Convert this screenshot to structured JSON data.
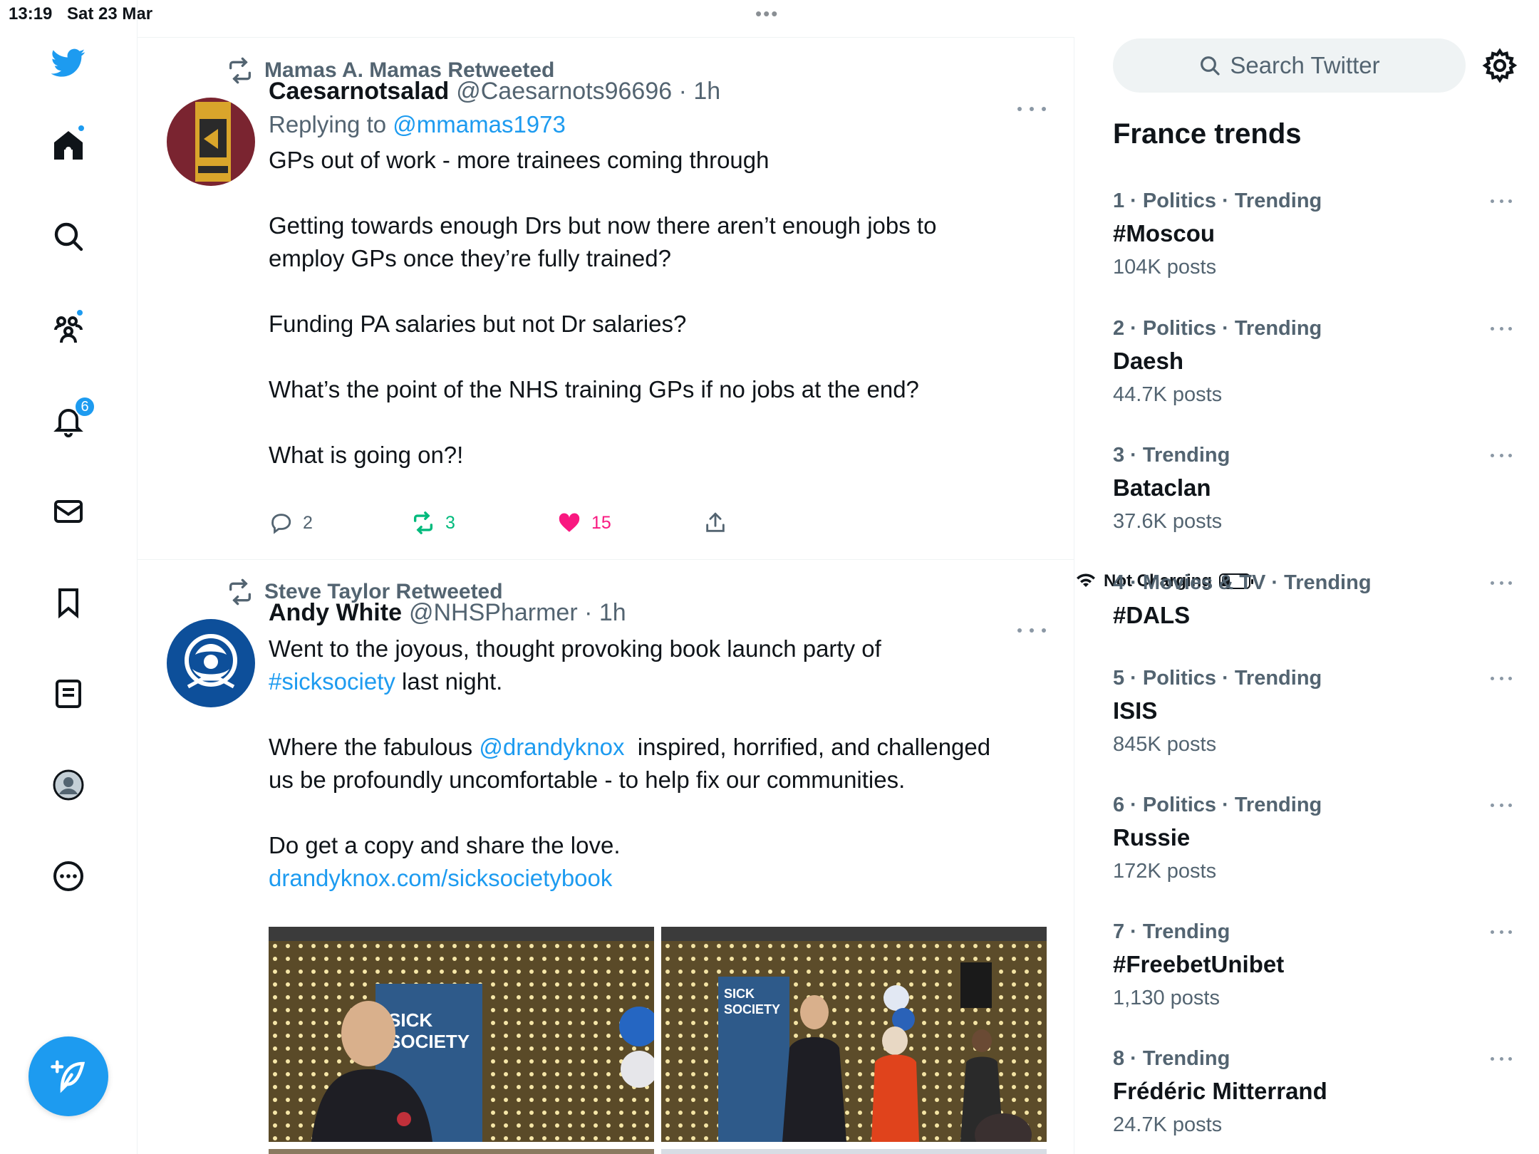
{
  "status_bar": {
    "time": "13:19",
    "date": "Sat 23 Mar",
    "charging": "Not Charging",
    "battery_fraction": 0.3
  },
  "colors": {
    "accent": "#1d9bf0",
    "like": "#f91880",
    "retweet": "#00ba7c",
    "muted": "#536471"
  },
  "sidebar": {
    "items": [
      {
        "icon": "twitter-bird-icon"
      },
      {
        "icon": "home-icon"
      },
      {
        "icon": "search-icon"
      },
      {
        "icon": "communities-icon"
      },
      {
        "icon": "bell-icon",
        "badge": "6"
      },
      {
        "icon": "mail-icon"
      },
      {
        "icon": "bookmark-icon"
      },
      {
        "icon": "list-icon"
      },
      {
        "icon": "profile-avatar-icon"
      },
      {
        "icon": "more-circle-icon"
      }
    ],
    "compose_icon": "compose-feather-icon"
  },
  "feed": {
    "tweets": [
      {
        "retweeted_by": "Mamas A. Mamas Retweeted",
        "name": "Caesarnotsalad",
        "handle": "@Caesarnots96696",
        "time": "1h",
        "replying_prefix": "Replying to",
        "replying_to": "@mmamas1973",
        "lines": [
          "GPs out of work - more trainees coming through",
          "Getting towards enough Drs but now there aren’t enough jobs to",
          "employ GPs once they’re fully trained?",
          "Funding PA salaries but not Dr salaries?",
          "What’s the point of the NHS training GPs if no jobs at the end?",
          "What is going on?!"
        ],
        "replies": "2",
        "retweets": "3",
        "likes": "15"
      },
      {
        "retweeted_by": "Steve Taylor Retweeted",
        "name": "Andy White",
        "handle": "@NHSPharmer",
        "time": "1h",
        "line1": "Went to the joyous, thought provoking book launch party of",
        "hashtag": "#sicksociety",
        "line2_rest": " last night.",
        "line3_pre": "Where the fabulous ",
        "mention": "@drandyknox",
        "line3_post": "  inspired, horrified, and challenged",
        "line4": "us be profoundly uncomfortable - to help fix our communities.",
        "line5": "Do get a copy and share the love.",
        "url": "drandyknox.com/sicksocietybook",
        "banner_text_1": "SICK\nSOCIETY",
        "banner_text_2": "SICK\nSOCIETY"
      }
    ]
  },
  "right": {
    "search_placeholder": "Search Twitter",
    "trends_title": "France trends",
    "trends": [
      {
        "meta": "1 · Politics · Trending",
        "name": "#Moscou",
        "count": "104K posts"
      },
      {
        "meta": "2 · Politics · Trending",
        "name": "Daesh",
        "count": "44.7K posts"
      },
      {
        "meta": "3 · Trending",
        "name": "Bataclan",
        "count": "37.6K posts"
      },
      {
        "meta": "4 · Movies & TV · Trending",
        "name": "#DALS",
        "count": ""
      },
      {
        "meta": "5 · Politics · Trending",
        "name": "ISIS",
        "count": "845K posts"
      },
      {
        "meta": "6 · Politics · Trending",
        "name": "Russie",
        "count": "172K posts"
      },
      {
        "meta": "7 · Trending",
        "name": "#FreebetUnibet",
        "count": "1,130 posts"
      },
      {
        "meta": "8 · Trending",
        "name": "Frédéric Mitterrand",
        "count": "24.7K posts"
      }
    ]
  }
}
